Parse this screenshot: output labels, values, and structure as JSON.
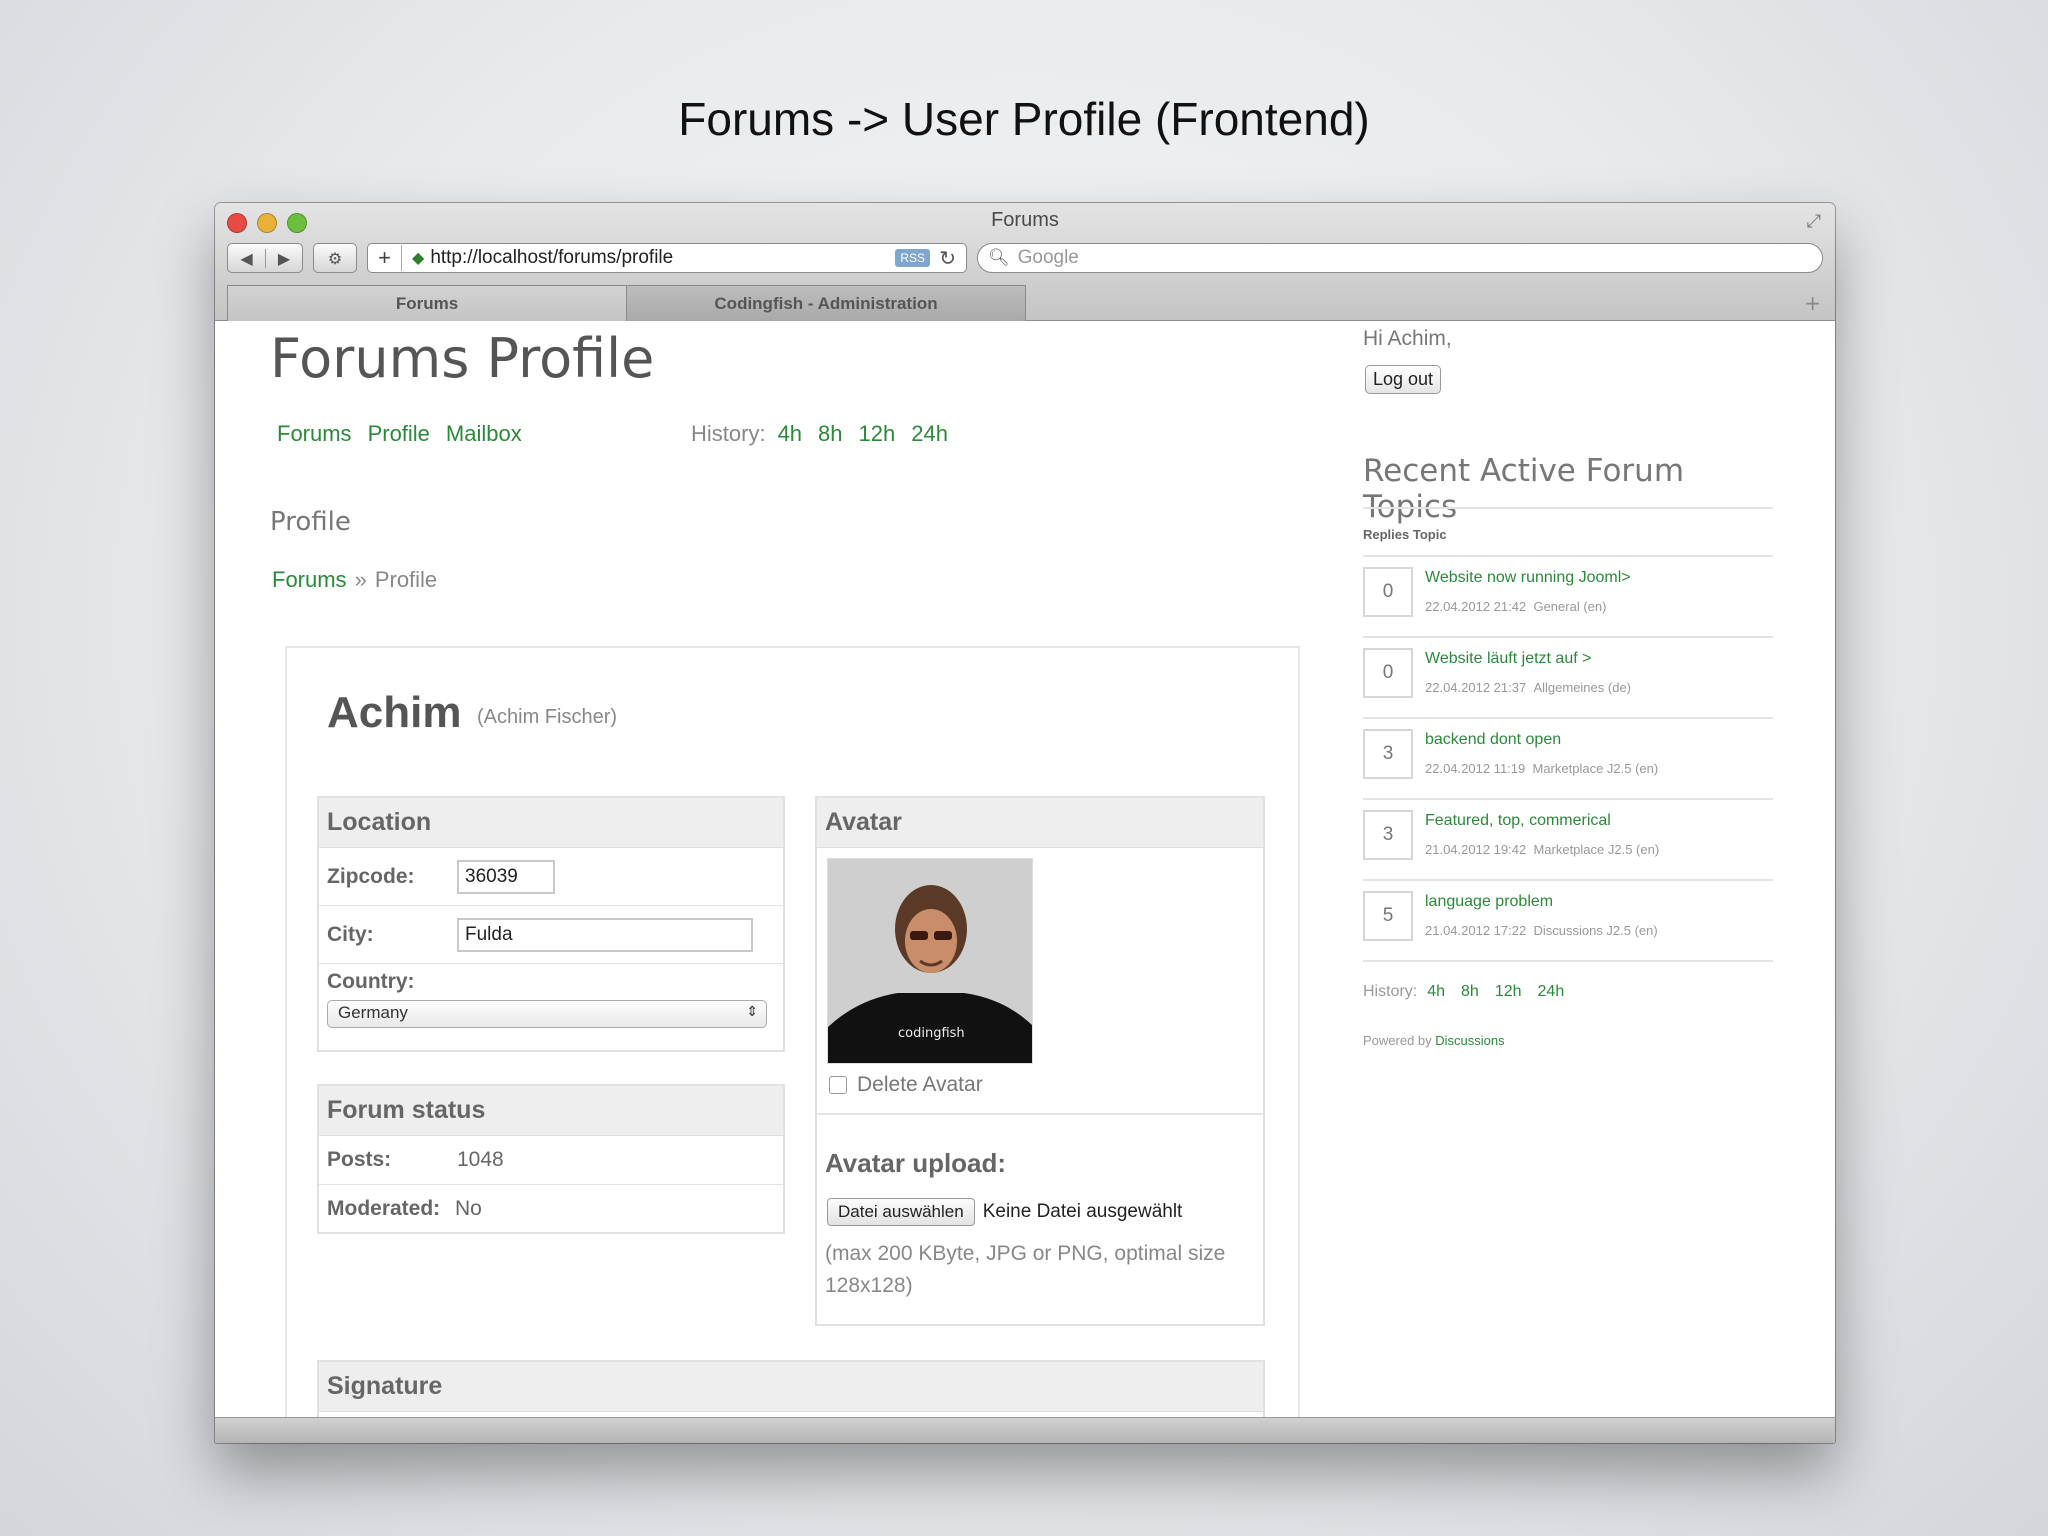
{
  "slide": {
    "title": "Forums -> User Profile (Frontend)"
  },
  "browser": {
    "window_title": "Forums",
    "url": "http://localhost/forums/profile",
    "rss_label": "RSS",
    "search_placeholder": "Google",
    "tabs": [
      {
        "label": "Forums"
      },
      {
        "label": "Codingfish - Administration"
      }
    ]
  },
  "page": {
    "title": "Forums Profile",
    "nav": {
      "forums": "Forums",
      "profile": "Profile",
      "mailbox": "Mailbox"
    },
    "history": {
      "label": "History:",
      "items": [
        "4h",
        "8h",
        "12h",
        "24h"
      ]
    },
    "section_heading": "Profile",
    "breadcrumb": {
      "root": "Forums",
      "sep": "»",
      "current": "Profile"
    }
  },
  "profile": {
    "username": "Achim",
    "fullname": "(Achim Fischer)",
    "location": {
      "heading": "Location",
      "zip_label": "Zipcode:",
      "zip_value": "36039",
      "city_label": "City:",
      "city_value": "Fulda",
      "country_label": "Country:",
      "country_value": "Germany"
    },
    "forum_status": {
      "heading": "Forum status",
      "posts_label": "Posts:",
      "posts_value": "1048",
      "moderated_label": "Moderated:",
      "moderated_value": "No"
    },
    "avatar": {
      "heading": "Avatar",
      "shirt_text": "codingfish",
      "delete_label": "Delete Avatar",
      "upload_heading": "Avatar upload:",
      "file_button": "Datei auswählen",
      "file_status": "Keine Datei ausgewählt",
      "upload_note": "(max 200 KByte, JPG or PNG, optimal size 128x128)"
    },
    "signature": {
      "heading": "Signature"
    }
  },
  "sidebar": {
    "greeting": "Hi Achim,",
    "logout": "Log out",
    "recent_title": "Recent Active Forum Topics",
    "table_header": "Replies Topic",
    "topics": [
      {
        "replies": "0",
        "title": "Website now running Jooml>",
        "date": "22.04.2012 21:42",
        "category": "General (en)"
      },
      {
        "replies": "0",
        "title": "Website läuft jetzt auf >",
        "date": "22.04.2012 21:37",
        "category": "Allgemeines (de)"
      },
      {
        "replies": "3",
        "title": "backend dont open",
        "date": "22.04.2012 11:19",
        "category": "Marketplace J2.5 (en)"
      },
      {
        "replies": "3",
        "title": "Featured, top, commerical",
        "date": "21.04.2012 19:42",
        "category": "Marketplace J2.5 (en)"
      },
      {
        "replies": "5",
        "title": "language problem",
        "date": "21.04.2012 17:22",
        "category": "Discussions J2.5 (en)"
      }
    ],
    "history": {
      "label": "History:",
      "items": [
        "4h",
        "8h",
        "12h",
        "24h"
      ]
    },
    "powered_by": "Powered by",
    "powered_link": "Discussions"
  },
  "colors": {
    "link": "#2a8a3a",
    "text": "#666666",
    "panel_header": "#eeeeee"
  }
}
